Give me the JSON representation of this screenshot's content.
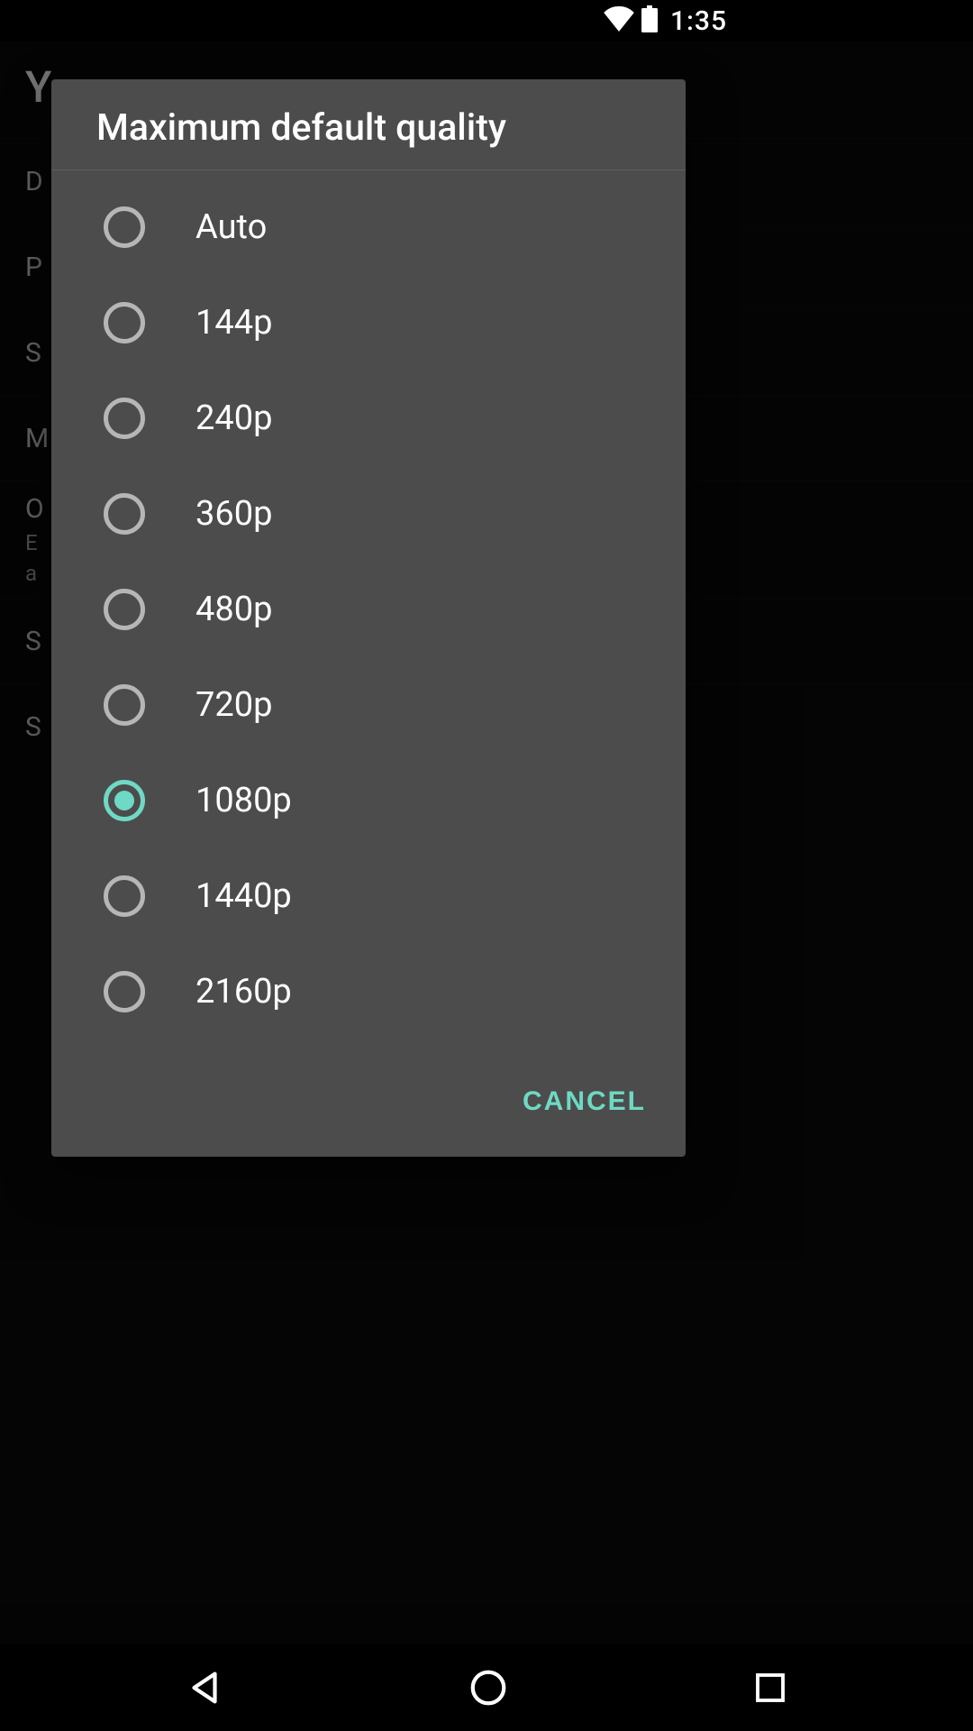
{
  "status": {
    "time": "1:35"
  },
  "background": {
    "header": "Y",
    "rows": [
      {
        "label": "D"
      },
      {
        "label": "P"
      },
      {
        "label": "S"
      },
      {
        "label": "M"
      },
      {
        "label": "O",
        "sub1": "E",
        "sub2": "a"
      },
      {
        "label": "S"
      },
      {
        "label": "S"
      }
    ]
  },
  "dialog": {
    "title": "Maximum default quality",
    "options": [
      {
        "label": "Auto",
        "selected": false
      },
      {
        "label": "144p",
        "selected": false
      },
      {
        "label": "240p",
        "selected": false
      },
      {
        "label": "360p",
        "selected": false
      },
      {
        "label": "480p",
        "selected": false
      },
      {
        "label": "720p",
        "selected": false
      },
      {
        "label": "1080p",
        "selected": true
      },
      {
        "label": "1440p",
        "selected": false
      },
      {
        "label": "2160p",
        "selected": false
      }
    ],
    "cancel_label": "CANCEL"
  },
  "colors": {
    "accent": "#6ed9c4"
  }
}
